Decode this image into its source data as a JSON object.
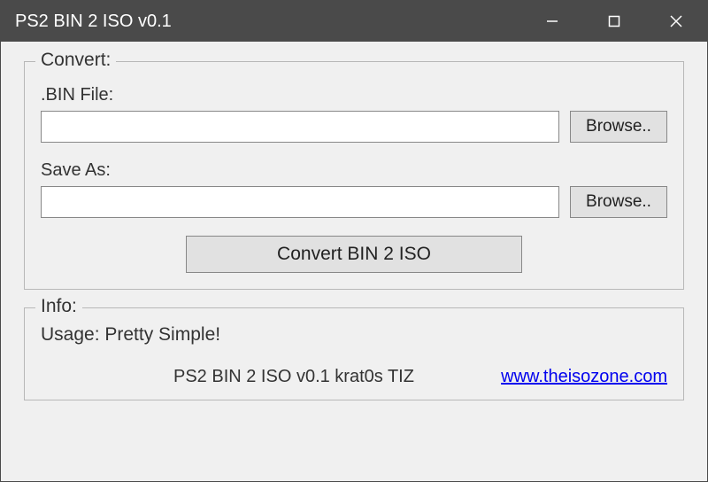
{
  "titlebar": {
    "title": "PS2 BIN 2 ISO v0.1"
  },
  "convert": {
    "legend": "Convert:",
    "bin_label": ".BIN File:",
    "bin_value": "",
    "saveas_label": "Save As:",
    "saveas_value": "",
    "browse_label": "Browse..",
    "convert_button": "Convert BIN 2 ISO"
  },
  "info": {
    "legend": "Info:",
    "usage": "Usage: Pretty Simple!",
    "version": "PS2 BIN 2 ISO v0.1 krat0s TIZ",
    "link": "www.theisozone.com"
  }
}
